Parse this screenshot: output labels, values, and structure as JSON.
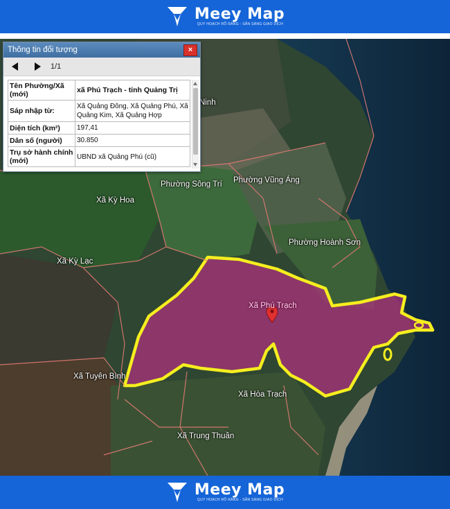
{
  "brand": {
    "name": "Meey Map",
    "tagline": "QUY HOẠCH RÕ RÀNG - SẴN SÀNG GIAO DỊCH"
  },
  "panel": {
    "title": "Thông tin đối tượng",
    "close_icon": "×",
    "pager": "1/1",
    "rows": [
      {
        "key": "Tên Phường/Xã (mới)",
        "value": "xã Phú Trạch - tỉnh Quảng Trị"
      },
      {
        "key": "Sáp nhập từ:",
        "value": "Xã Quảng Đông, Xã Quảng Phú, Xã Quảng Kim, Xã Quảng Hợp"
      },
      {
        "key": "Diện tích (km²)",
        "value": "197,41"
      },
      {
        "key": "Dân số (người)",
        "value": "30.850"
      },
      {
        "key": "Trụ sở hành chính (mới)",
        "value": "UBND xã Quảng Phú (cũ)"
      }
    ]
  },
  "map": {
    "labels": {
      "ninh": "Ninh",
      "song_tri": "Phường Sông Trí",
      "vung_ang": "Phường Vũng Áng",
      "ky_hoa": "Xã Kỳ Hoa",
      "hoanh_son": "Phường Hoành Sơn",
      "ky_lac": "Xã Kỳ Lạc",
      "phu_trach": "Xã Phú Trạch",
      "tuyen_binh": "Xã Tuyên Bình",
      "hoa_trach": "Xã Hòa Trạch",
      "trung_thuan": "Xã Trung Thuần"
    },
    "colors": {
      "highlight_fill": "#b0307e",
      "highlight_outline": "#f5ee1f",
      "boundary": "#e07a74",
      "sea": "#0f2a44",
      "marker": "#e03030"
    }
  }
}
